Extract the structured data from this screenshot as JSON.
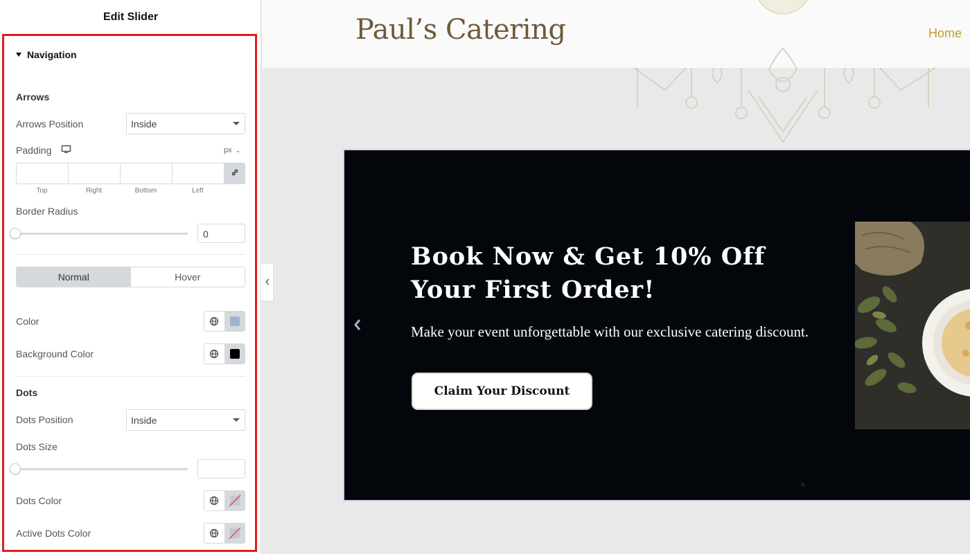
{
  "panel": {
    "title": "Edit Slider",
    "section": "Navigation",
    "arrows": {
      "title": "Arrows",
      "position_label": "Arrows Position",
      "position_value": "Inside",
      "padding_label": "Padding",
      "padding_unit": "px",
      "dimension_labels": [
        "Top",
        "Right",
        "Bottom",
        "Left"
      ],
      "border_radius_label": "Border Radius",
      "border_radius_value": "0",
      "tab_normal": "Normal",
      "tab_hover": "Hover",
      "color_label": "Color",
      "color_value": "#9fb3cf",
      "bg_color_label": "Background Color",
      "bg_color_value": "#000000"
    },
    "dots": {
      "title": "Dots",
      "position_label": "Dots Position",
      "position_value": "Inside",
      "size_label": "Dots Size",
      "size_value": "",
      "color_label": "Dots Color",
      "active_color_label": "Active Dots Color"
    }
  },
  "site": {
    "logo": "Paul’s Catering",
    "nav_home": "Home",
    "slide": {
      "title": "Book Now & Get 10% Off Your First Order!",
      "description": "Make your event unforgettable with our exclusive catering discount.",
      "cta": "Claim Your Discount"
    }
  },
  "icons": [
    "caret-down-icon",
    "desktop-icon",
    "link-icon",
    "globe-icon",
    "chevron-left-icon"
  ]
}
